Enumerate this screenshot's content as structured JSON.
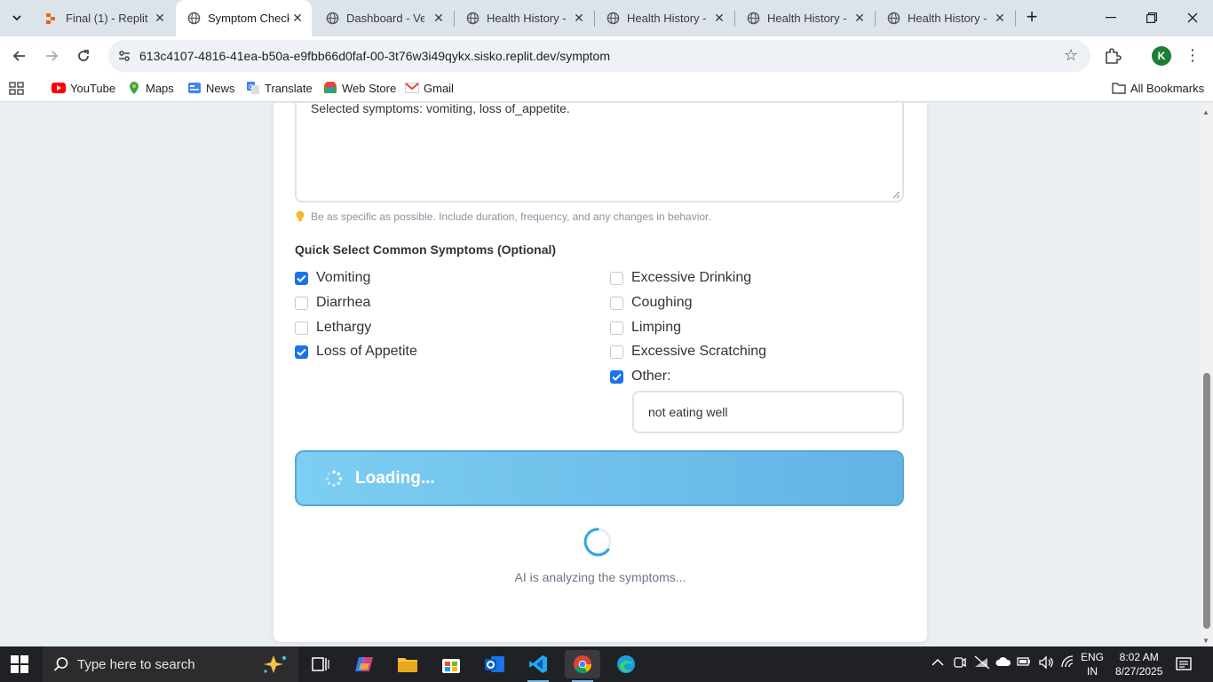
{
  "browser": {
    "tabs": [
      {
        "title": "Final (1) - Replit",
        "active": false
      },
      {
        "title": "Symptom Check",
        "active": true
      },
      {
        "title": "Dashboard - Vet",
        "active": false
      },
      {
        "title": "Health History -",
        "active": false
      },
      {
        "title": "Health History -",
        "active": false
      },
      {
        "title": "Health History -",
        "active": false
      },
      {
        "title": "Health History -",
        "active": false
      }
    ],
    "url": "613c4107-4816-41ea-b50a-e9fbb66d0faf-00-3t76w3i49qykx.sisko.replit.dev/symptom",
    "profile_initial": "K",
    "bookmarks": [
      "YouTube",
      "Maps",
      "News",
      "Translate",
      "Web Store",
      "Gmail"
    ],
    "all_bookmarks": "All Bookmarks"
  },
  "form": {
    "textarea_text": "Selected symptoms: vomiting, loss of_appetite.",
    "hint": "Be as specific as possible. Include duration, frequency, and any changes in behavior.",
    "quick_select_title": "Quick Select Common Symptoms (Optional)",
    "symptoms_left": [
      {
        "label": "Vomiting",
        "checked": true
      },
      {
        "label": "Diarrhea",
        "checked": false
      },
      {
        "label": "Lethargy",
        "checked": false
      },
      {
        "label": "Loss of Appetite",
        "checked": true
      }
    ],
    "symptoms_right": [
      {
        "label": "Excessive Drinking",
        "checked": false
      },
      {
        "label": "Coughing",
        "checked": false
      },
      {
        "label": "Limping",
        "checked": false
      },
      {
        "label": "Excessive Scratching",
        "checked": false
      },
      {
        "label": "Other:",
        "checked": true
      }
    ],
    "other_value": "not eating well",
    "loading_label": "Loading...",
    "analyzing_text": "AI is analyzing the symptoms..."
  },
  "taskbar": {
    "search_placeholder": "Type here to search",
    "lang_line1": "ENG",
    "lang_line2": "IN",
    "time": "8:02 AM",
    "date": "8/27/2025"
  },
  "colors": {
    "accent": "#1a73e8",
    "loading_button": "#6cc0ec",
    "spinner": "#2fa8e0"
  }
}
